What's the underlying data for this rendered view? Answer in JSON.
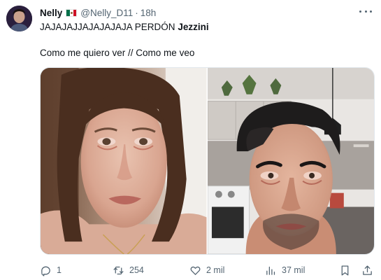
{
  "author": {
    "name": "Nelly",
    "flag_icon": "mexico-flag-icon",
    "handle": "@Nelly_D11",
    "separator": "·",
    "time": "18h"
  },
  "tweet": {
    "text_prefix": "JAJAJAJJAJAJAJAJA PERDÓN ",
    "mention": "Jezzini",
    "caption": "Como me quiero ver // Como me veo"
  },
  "media": {
    "photos": [
      {
        "icon": "woman-crying-photo"
      },
      {
        "icon": "man-tired-kitchen-photo"
      }
    ]
  },
  "actions": {
    "reply_count": "1",
    "retweet_count": "254",
    "like_count": "2 mil",
    "views_count": "37 mil"
  },
  "colors": {
    "text": "#0f1419",
    "secondary": "#536471",
    "border": "#e1e8ed"
  }
}
